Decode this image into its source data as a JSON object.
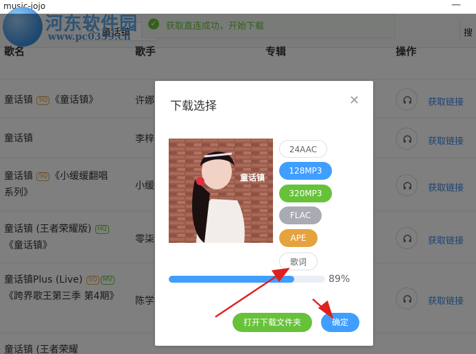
{
  "window": {
    "title": "music-jojo",
    "minimize_glyph": "—"
  },
  "watermark": {
    "line1": "河东软件园",
    "line2": "www.pc0359.cn"
  },
  "search": {
    "value": "童话镇",
    "right_segment": "搜"
  },
  "toast": {
    "text": "获取直连成功，开始下载"
  },
  "table": {
    "headers": {
      "song": "歌名",
      "artist": "歌手",
      "album": "专辑",
      "action": "操作"
    },
    "rows": [
      {
        "song": "童话镇",
        "tags": [
          "SQ"
        ],
        "album": "《童话镇》",
        "artist": "许娜",
        "link": "获取链接"
      },
      {
        "song": "童话镇",
        "tags": [],
        "album": "",
        "artist": "李梓",
        "link": "获取链接"
      },
      {
        "song": "童话镇",
        "tags": [
          "SQ"
        ],
        "album": "《小缓缓翻唱系列》",
        "artist": "小缓",
        "link": "获取链接"
      },
      {
        "song": "童话镇 (王者荣耀版)",
        "tags": [
          "HQ"
        ],
        "album": "《童话镇》",
        "artist": "零柒",
        "link": "获取链接"
      },
      {
        "song": "童话镇Plus (Live)",
        "tags": [
          "SQ",
          "MV"
        ],
        "album": "《跨界歌王第三季 第4期》",
        "artist": "陈学",
        "link": "获取链接"
      },
      {
        "song": "童话镇 (王者荣耀",
        "tags": [],
        "album": "",
        "artist": "",
        "link": ""
      }
    ]
  },
  "dialog": {
    "title": "下载选择",
    "cover_text": "童话镇",
    "formats": [
      {
        "label": "24AAC",
        "style": "outline"
      },
      {
        "label": "128MP3",
        "style": "blue"
      },
      {
        "label": "320MP3",
        "style": "green"
      },
      {
        "label": "FLAC",
        "style": "gray"
      },
      {
        "label": "APE",
        "style": "orange"
      },
      {
        "label": "歌词",
        "style": "outline"
      }
    ],
    "progress": {
      "percent": 89,
      "label": "89%"
    },
    "open_folder_label": "打开下载文件夹",
    "ok_label": "确定"
  },
  "colors": {
    "blue": "#409eff",
    "green": "#67c23a",
    "gray": "#a8abb2",
    "orange": "#e6a23c",
    "link": "#3a86e6",
    "arrow": "#e0201f"
  }
}
